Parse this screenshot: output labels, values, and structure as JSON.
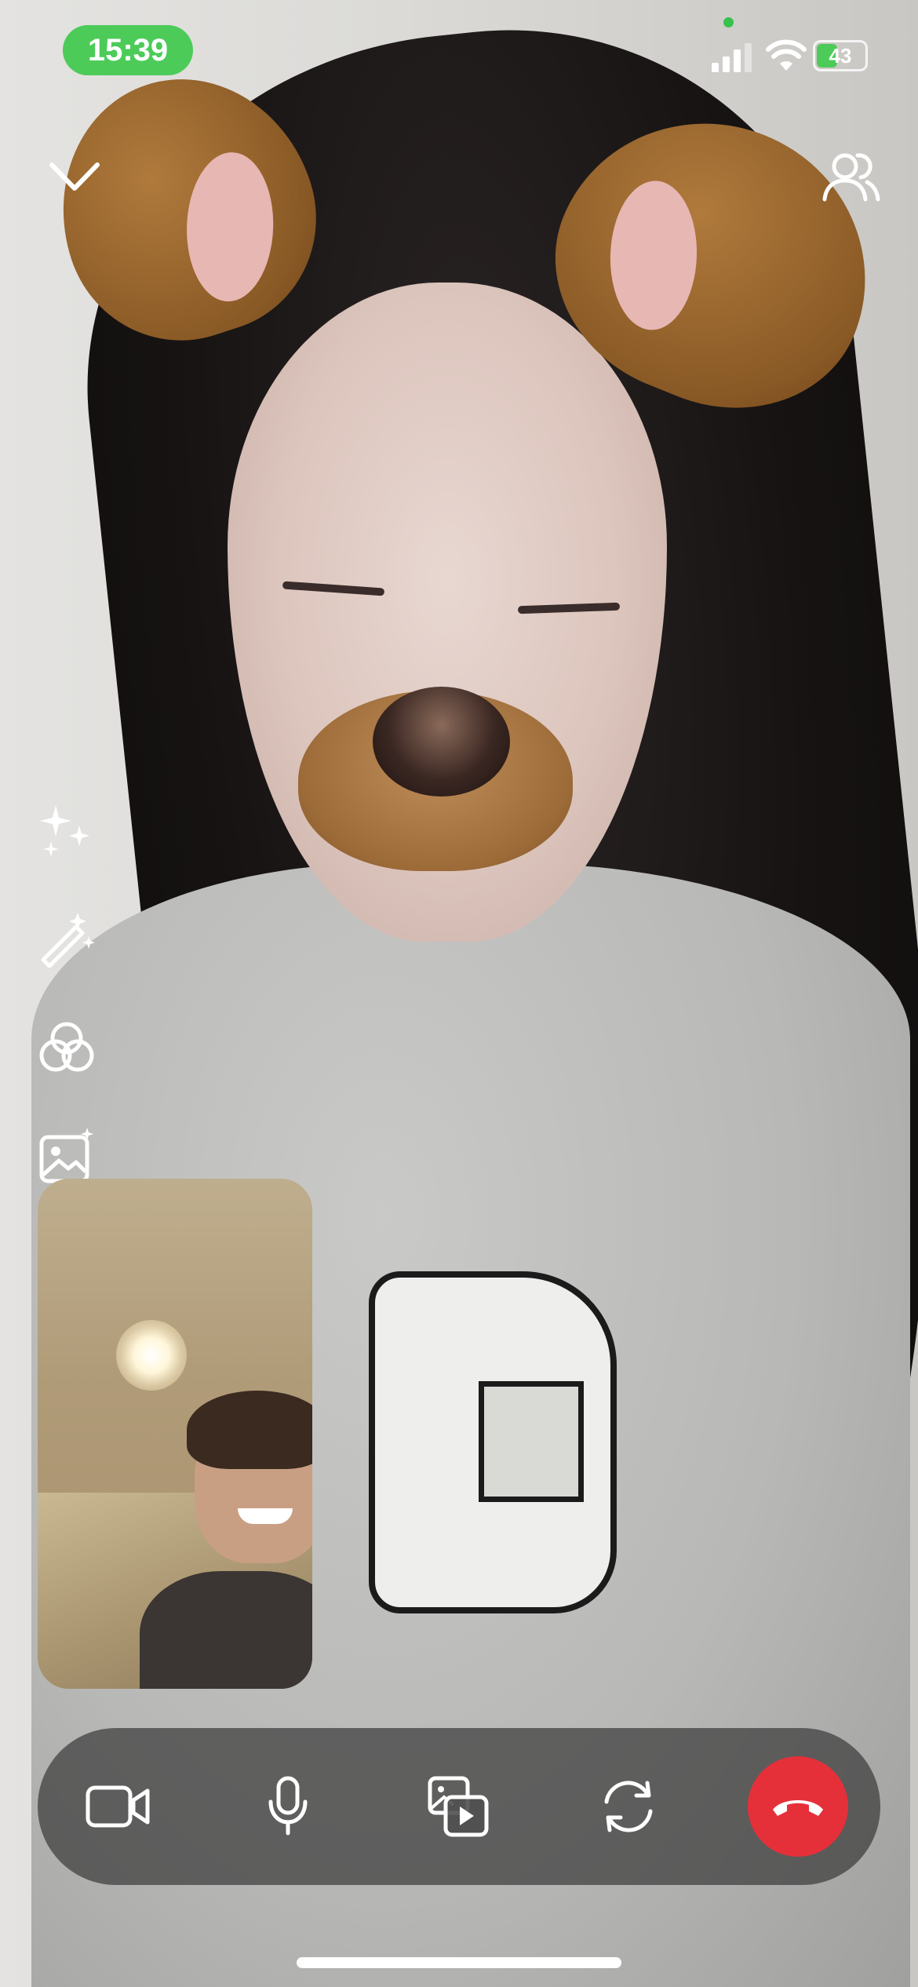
{
  "status_bar": {
    "time": "15:39",
    "battery_percent": "43",
    "signal_icon": "cellular-signal-icon",
    "wifi_icon": "wifi-icon",
    "battery_icon": "battery-charging-icon"
  },
  "top_controls": {
    "collapse_icon": "chevron-down-icon",
    "participants_icon": "participants-icon"
  },
  "effects_tools": [
    {
      "icon": "sparkles-icon"
    },
    {
      "icon": "magic-wand-icon"
    },
    {
      "icon": "filters-icon"
    },
    {
      "icon": "background-image-icon"
    }
  ],
  "call_controls": [
    {
      "icon": "video-camera-icon"
    },
    {
      "icon": "microphone-icon"
    },
    {
      "icon": "share-media-icon"
    },
    {
      "icon": "flip-camera-icon"
    },
    {
      "icon": "end-call-icon"
    }
  ],
  "colors": {
    "time_pill": "#4ccb59",
    "end_call": "#e5303a",
    "call_bar": "rgba(60,60,60,0.72)"
  }
}
